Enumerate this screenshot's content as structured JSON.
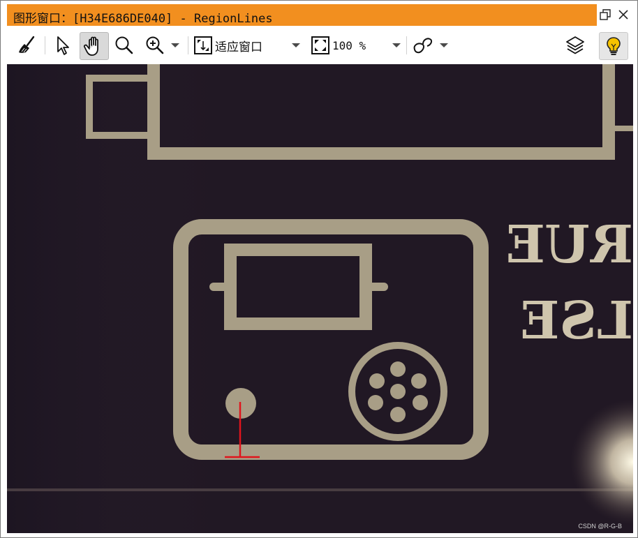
{
  "window": {
    "title": "图形窗口：[H34E686DE040] - RegionLines",
    "buttons": [
      {
        "name": "restore",
        "icon": "restore-window-icon"
      },
      {
        "name": "close",
        "icon": "close-icon"
      }
    ]
  },
  "toolbar": {
    "tools": [
      {
        "name": "clear",
        "icon": "broom-icon"
      },
      {
        "name": "select",
        "icon": "pointer-arrow-icon"
      },
      {
        "name": "pan",
        "icon": "hand-icon",
        "active": true
      },
      {
        "name": "magnify",
        "icon": "magnifier-icon"
      },
      {
        "name": "zoom",
        "icon": "zoom-in-icon"
      }
    ],
    "fit_mode": {
      "icon": "fit-window-icon",
      "label": "适应窗口"
    },
    "zoom_level": {
      "icon": "zoom-percent-icon",
      "value": "100 %"
    },
    "draw_mode": {
      "icon": "region-shape-icon"
    },
    "layers": {
      "icon": "layers-icon"
    },
    "hints": {
      "icon": "lightbulb-icon",
      "color": "#f6c200"
    }
  },
  "image": {
    "background_color": "#211824",
    "silkscreen_color": "#a89e86",
    "text_lines": [
      "RUE",
      "LSE"
    ],
    "overlay": {
      "type": "region-lines",
      "color": "#e0141c"
    }
  },
  "watermark": "CSDN @R-G-B"
}
